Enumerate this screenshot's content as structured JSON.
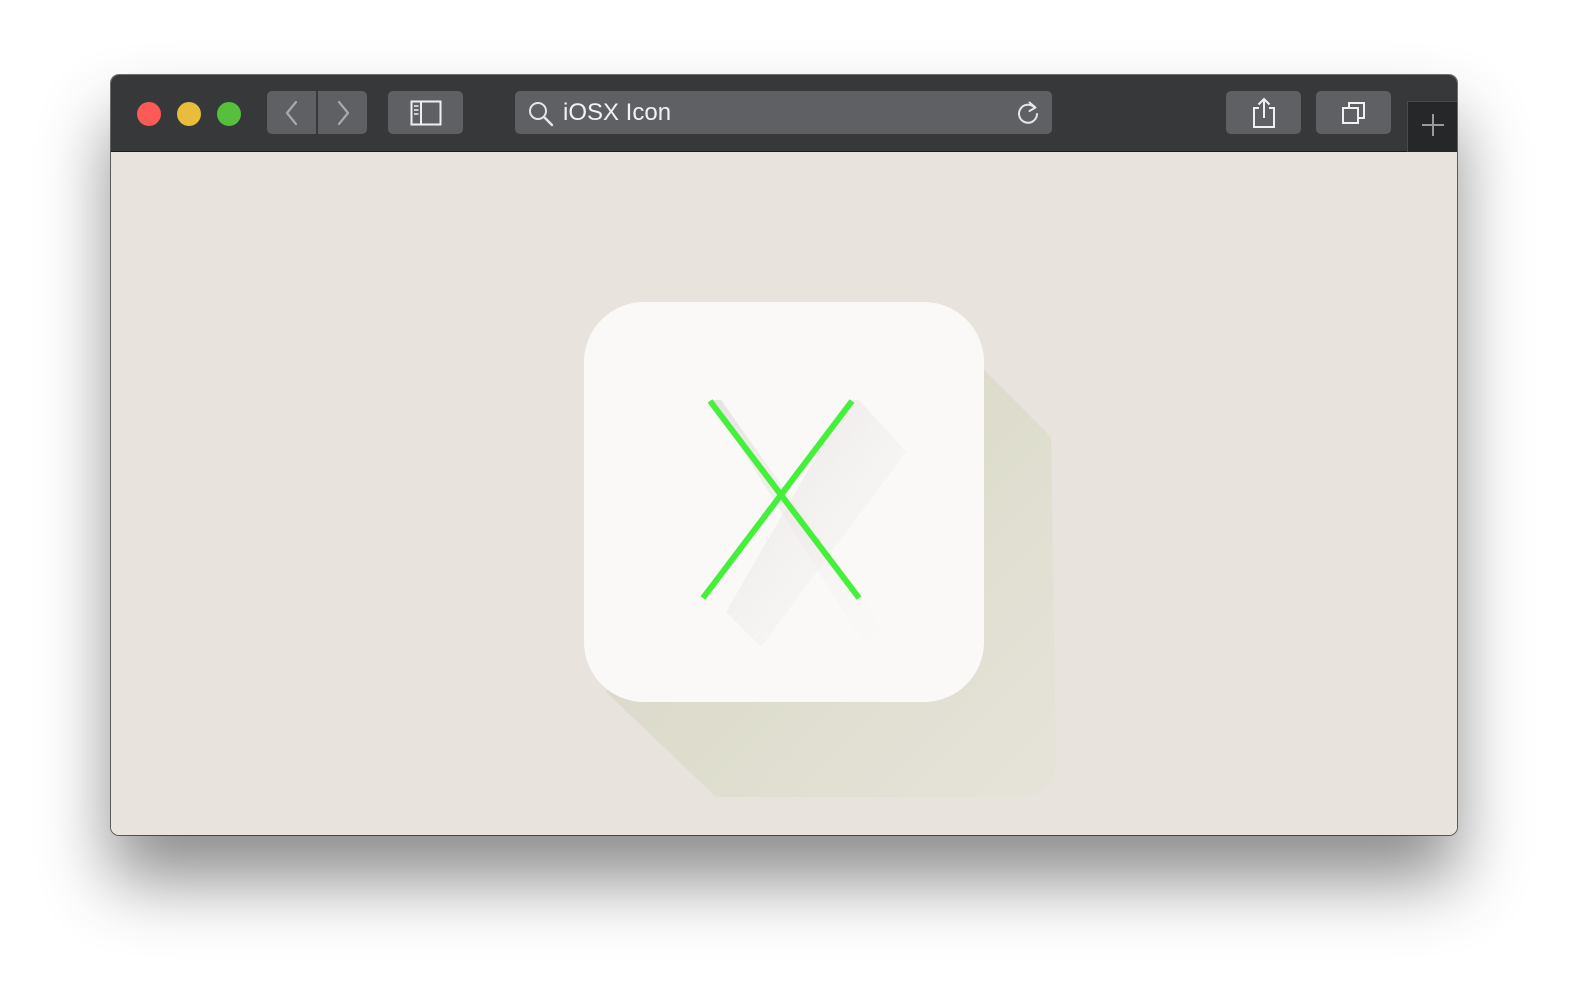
{
  "window": {
    "controls": {
      "close": "close-button",
      "minimize": "minimize-button",
      "zoom": "zoom-button"
    }
  },
  "toolbar": {
    "back_icon": "chevron-left-icon",
    "forward_icon": "chevron-right-icon",
    "sidebar_icon": "sidebar-icon",
    "share_icon": "share-icon",
    "tabs_icon": "tabs-overview-icon",
    "new_tab_icon": "plus-icon"
  },
  "address_bar": {
    "text": "iOSX Icon",
    "search_icon": "search-icon",
    "reload_icon": "reload-icon"
  },
  "page": {
    "app_icon": {
      "glyph": "X",
      "glyph_color": "#44f03a",
      "tile_color": "#faf9f7",
      "background_color": "#e8e3dd"
    }
  },
  "colors": {
    "toolbar": "#37383a",
    "button": "#5f6063",
    "close": "#fc5a56",
    "minimize": "#e9bc3d",
    "zoom": "#56c03d"
  }
}
